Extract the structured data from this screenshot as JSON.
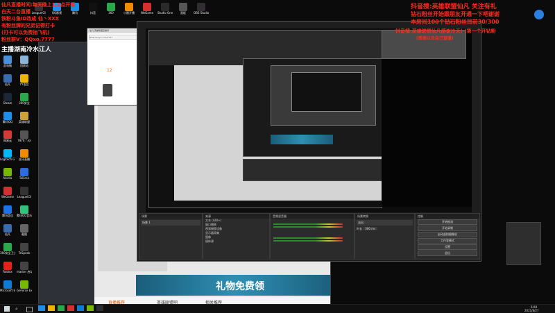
{
  "overlay": {
    "left_lines": [
      "仙凡直播时间:每天晚上1.2点开播",
      "白天二台直播",
      "铁粉斗鱼ID改成 仙丶XXX",
      "有粉丝牌的兄弟记得打卡",
      "(打卡可以免费抽飞机)",
      "粉丝群V：QQxo.7777",
      "主播湖南冷水江人"
    ],
    "right_lines": [
      "抖音搜:英雄联盟仙凡  关注有礼",
      "钻石粉丝开始跟朋友开通一下吧谢谢",
      "本房间100个钻石粉丝目前30/300"
    ],
    "nested_lines": [
      "抖音搜:英雄联盟仙凡感谢冷天(    )第一个开钻粉",
      "(感谢以及自己直播)"
    ]
  },
  "desktop_icons": [
    {
      "label": "此电脑",
      "color": "#4a90d9"
    },
    {
      "label": "回收站",
      "color": "#8ab4d8"
    },
    {
      "label": "仙凡",
      "color": "#3a6ab0"
    },
    {
      "label": "YY语音",
      "color": "#f0b400"
    },
    {
      "label": "Steam",
      "color": "#1b2838"
    },
    {
      "label": "360安全",
      "color": "#2aa94a"
    },
    {
      "label": "腾讯QQ",
      "color": "#1e8fe8"
    },
    {
      "label": "英雄联盟",
      "color": "#c9a23a"
    },
    {
      "label": "网易云",
      "color": "#d43c33"
    },
    {
      "label": "7870.*.lol",
      "color": "#555"
    },
    {
      "label": "Logitech G HUB",
      "color": "#00b8fc"
    },
    {
      "label": "虎牙直播",
      "color": "#f08c00"
    },
    {
      "label": "Nvidia",
      "color": "#76b900"
    },
    {
      "label": "ToDesk",
      "color": "#2d6cdf"
    },
    {
      "label": "WeGame",
      "color": "#d62f2f"
    },
    {
      "label": "LeaguelCli",
      "color": "#333"
    },
    {
      "label": "腾讯会议",
      "color": "#1a73e8"
    },
    {
      "label": "腾讯QQ音乐",
      "color": "#31c27c"
    },
    {
      "label": "仙凡",
      "color": "#3a6ab0"
    },
    {
      "label": "截图",
      "color": "#666"
    },
    {
      "label": "360安全卫士",
      "color": "#2aa94a"
    },
    {
      "label": "TeSpeak",
      "color": "#444"
    },
    {
      "label": "Roblox",
      "color": "#e2231a"
    },
    {
      "label": "master 启动",
      "color": "#444"
    },
    {
      "label": "Microsoft Edge",
      "color": "#0c7cd5"
    },
    {
      "label": "GeForce Experience",
      "color": "#76b900"
    }
  ],
  "top_icons": [
    {
      "label": "LeaguelCli",
      "color": "#333"
    },
    {
      "label": "QQ影视",
      "color": "#1e8fe8"
    },
    {
      "label": "腾讯",
      "color": "#1e8fe8"
    },
    {
      "label": "抖音",
      "color": "#111"
    },
    {
      "label": "360",
      "color": "#2aa94a"
    },
    {
      "label": "小鹅开播",
      "color": "#f08c00"
    },
    {
      "label": "WeGame",
      "color": "#d62f2f"
    },
    {
      "label": "Studio One",
      "color": "#2a2a2a"
    },
    {
      "label": "画板",
      "color": "#555"
    },
    {
      "label": "OBS Studio",
      "color": "#302e31"
    }
  ],
  "browser": {
    "tab": "仙凡 英雄联盟直播间",
    "url": "www.douyu.com/7777",
    "banner_text": "礼物免费领",
    "tabs": [
      "直播推荐",
      "英雄联盟吧",
      "相关推荐"
    ],
    "counter": "12"
  },
  "obs": {
    "scenes_title": "场景",
    "sources_title": "来源",
    "mixer_title": "音频混音器",
    "transitions_title": "场景转换",
    "controls_title": "控制",
    "sources": [
      "文本 (GDI+)",
      "窗口捕获",
      "视频捕获设备",
      "显示器采集",
      "图像",
      "媒体源"
    ],
    "transition_value": "淡出",
    "duration_label": "时长",
    "duration_value": "300 ms",
    "controls": [
      "开始推流",
      "开始录制",
      "启动虚拟摄像机",
      "工作室模式",
      "设置",
      "退出"
    ],
    "scene": "场景 1"
  },
  "taskbar": {
    "time": "6:08",
    "date": "2021/8/27"
  }
}
